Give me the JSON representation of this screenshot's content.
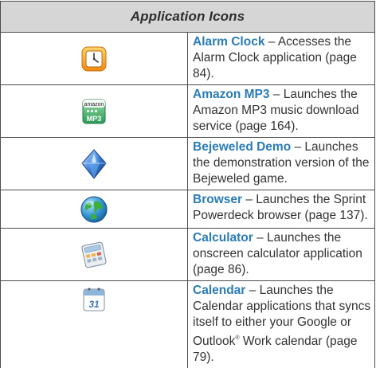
{
  "table": {
    "caption": "Application Icons",
    "rows": [
      {
        "icon": "alarm-clock-icon",
        "name": "Alarm Clock",
        "dash": " – ",
        "text": "Accesses the Alarm Clock application (page 84)."
      },
      {
        "icon": "amazon-mp3-icon",
        "name": "Amazon MP3",
        "dash": " – ",
        "text": "Launches the Amazon MP3 music download service (page 164)."
      },
      {
        "icon": "bejeweled-gem-icon",
        "name": "Bejeweled Demo",
        "dash": " – ",
        "text": "Launches the demonstration version of the Bejeweled game."
      },
      {
        "icon": "browser-globe-icon",
        "name": "Browser",
        "dash": " – ",
        "text": "Launches the Sprint Powerdeck browser (page 137)."
      },
      {
        "icon": "calculator-icon",
        "name": "Calculator",
        "dash": " – ",
        "text": "Launches the onscreen calculator application (page 86)."
      },
      {
        "icon": "calendar-icon",
        "name": "Calendar",
        "dash": " – ",
        "text_a": "Launches the Calendar applications that syncs itself to either your Google or Outlook",
        "reg_mark": "®",
        "text_b": " Work calendar (page 79)."
      }
    ],
    "amazon_icon_text": {
      "top": "amazon",
      "bottom": "MP3"
    },
    "calendar_icon_text": "31"
  }
}
